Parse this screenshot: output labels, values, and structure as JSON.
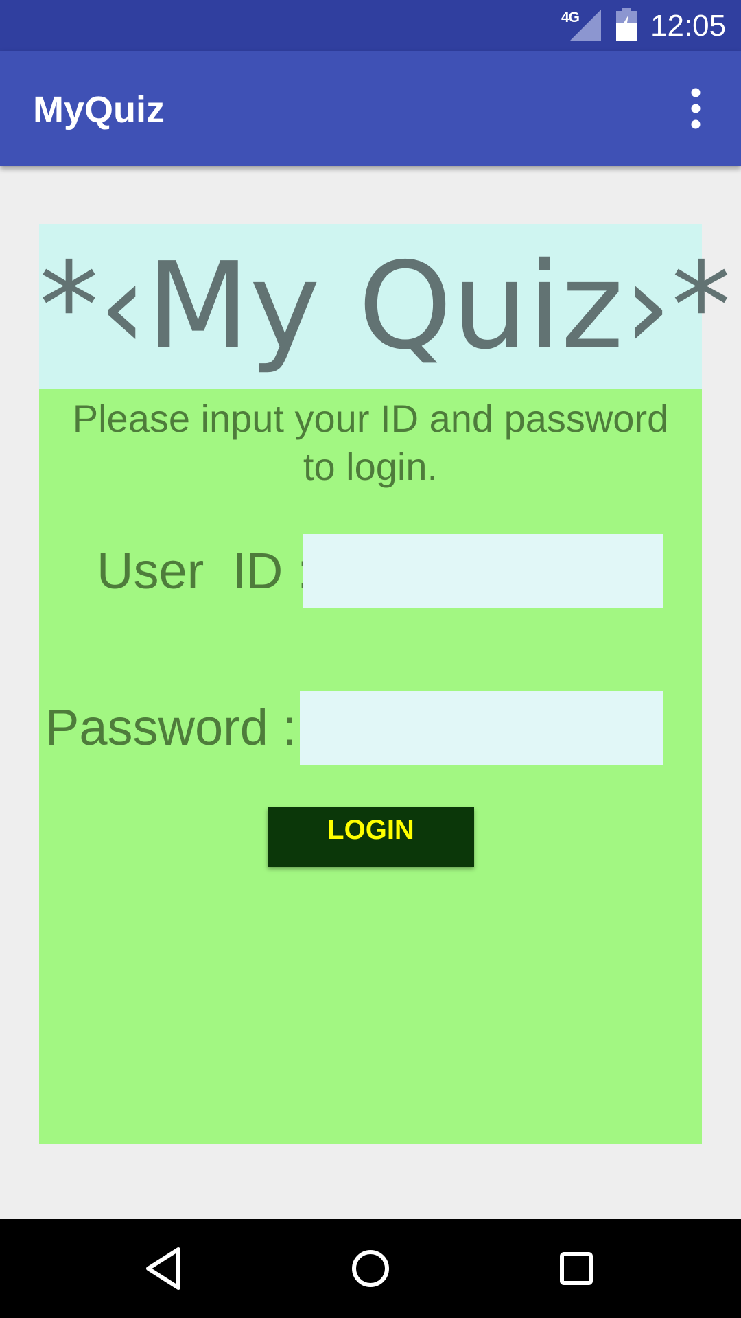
{
  "status_bar": {
    "network": "4G",
    "time": "12:05",
    "icons": [
      "signal-icon",
      "battery-charging-icon"
    ]
  },
  "app_bar": {
    "title": "MyQuiz",
    "menu_icon": "more-vert-icon"
  },
  "login_card": {
    "heading": "*‹My Quiz›*",
    "instruction_line1": "Please input your ID and password",
    "instruction_line2": "to login.",
    "user_id_label": "User  ID :",
    "user_id_value": "",
    "password_label": "Password :",
    "password_value": "",
    "login_button": "LOGIN"
  },
  "nav_bar": {
    "icons": [
      "back-icon",
      "home-icon",
      "recents-icon"
    ]
  },
  "colors": {
    "status_bar": "#303f9f",
    "app_bar": "#3f51b5",
    "card_background": "#a2f782",
    "header_band": "#cff5f1",
    "input_background": "#e1f7f7",
    "login_button": "#0b3709",
    "login_text": "#ffff00",
    "label_text": "#4e7c3b"
  }
}
